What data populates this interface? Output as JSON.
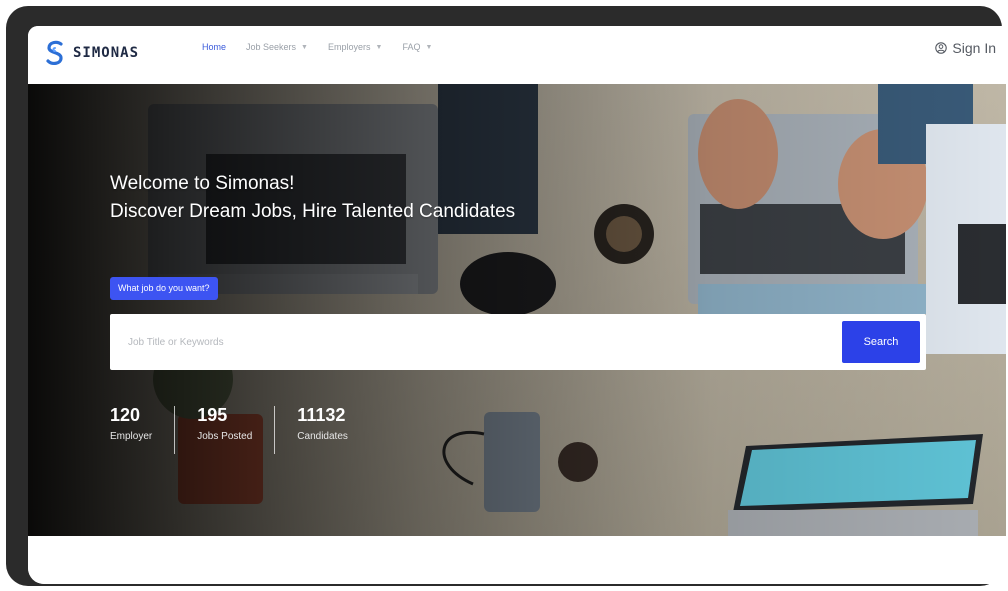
{
  "brand": {
    "name": "SIMONAS",
    "logo_icon": "simonas-s-logo-icon",
    "accent": "#2c6fd6"
  },
  "nav": {
    "items": [
      {
        "label": "Home",
        "active": true,
        "dropdown": false
      },
      {
        "label": "Job Seekers",
        "active": false,
        "dropdown": true
      },
      {
        "label": "Employers",
        "active": false,
        "dropdown": true
      },
      {
        "label": "FAQ",
        "active": false,
        "dropdown": true
      }
    ],
    "signin": {
      "label": "Sign In",
      "icon": "user-circle-icon"
    }
  },
  "hero": {
    "title_line1": "Welcome to Simonas!",
    "title_line2": "Discover Dream Jobs, Hire Talented Candidates",
    "badge": "What job do you want?",
    "search": {
      "placeholder": "Job Title or Keywords",
      "value": "",
      "button_label": "Search",
      "button_color": "#2c41e8"
    },
    "stats": [
      {
        "value": "120",
        "label": "Employer"
      },
      {
        "value": "195",
        "label": "Jobs Posted"
      },
      {
        "value": "11132",
        "label": "Candidates"
      }
    ]
  }
}
